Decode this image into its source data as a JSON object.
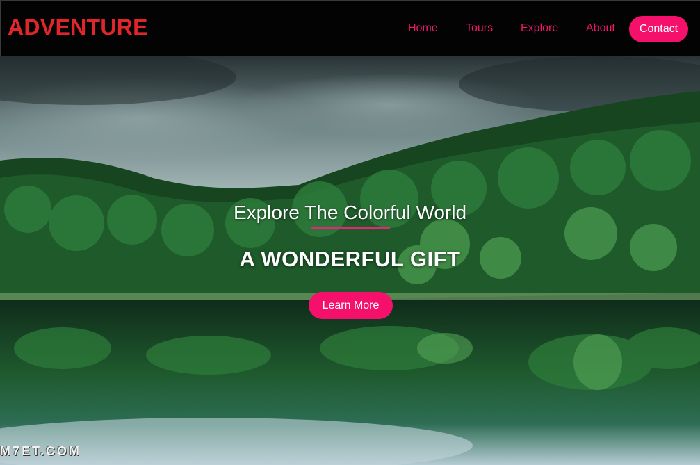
{
  "brand": {
    "logo": "ADVENTURE"
  },
  "nav": {
    "items": [
      {
        "label": "Home"
      },
      {
        "label": "Tours"
      },
      {
        "label": "Explore"
      },
      {
        "label": "About"
      }
    ],
    "contact_label": "Contact"
  },
  "hero": {
    "tagline": "Explore The Colorful World",
    "headline": "A WONDERFUL GIFT",
    "button_label": "Learn More",
    "watermark": "M7ET.COM"
  },
  "colors": {
    "logo": "#e0262b",
    "accent": "#f5116b",
    "nav_text": "#f0186a",
    "navbar_bg": "#030303"
  }
}
